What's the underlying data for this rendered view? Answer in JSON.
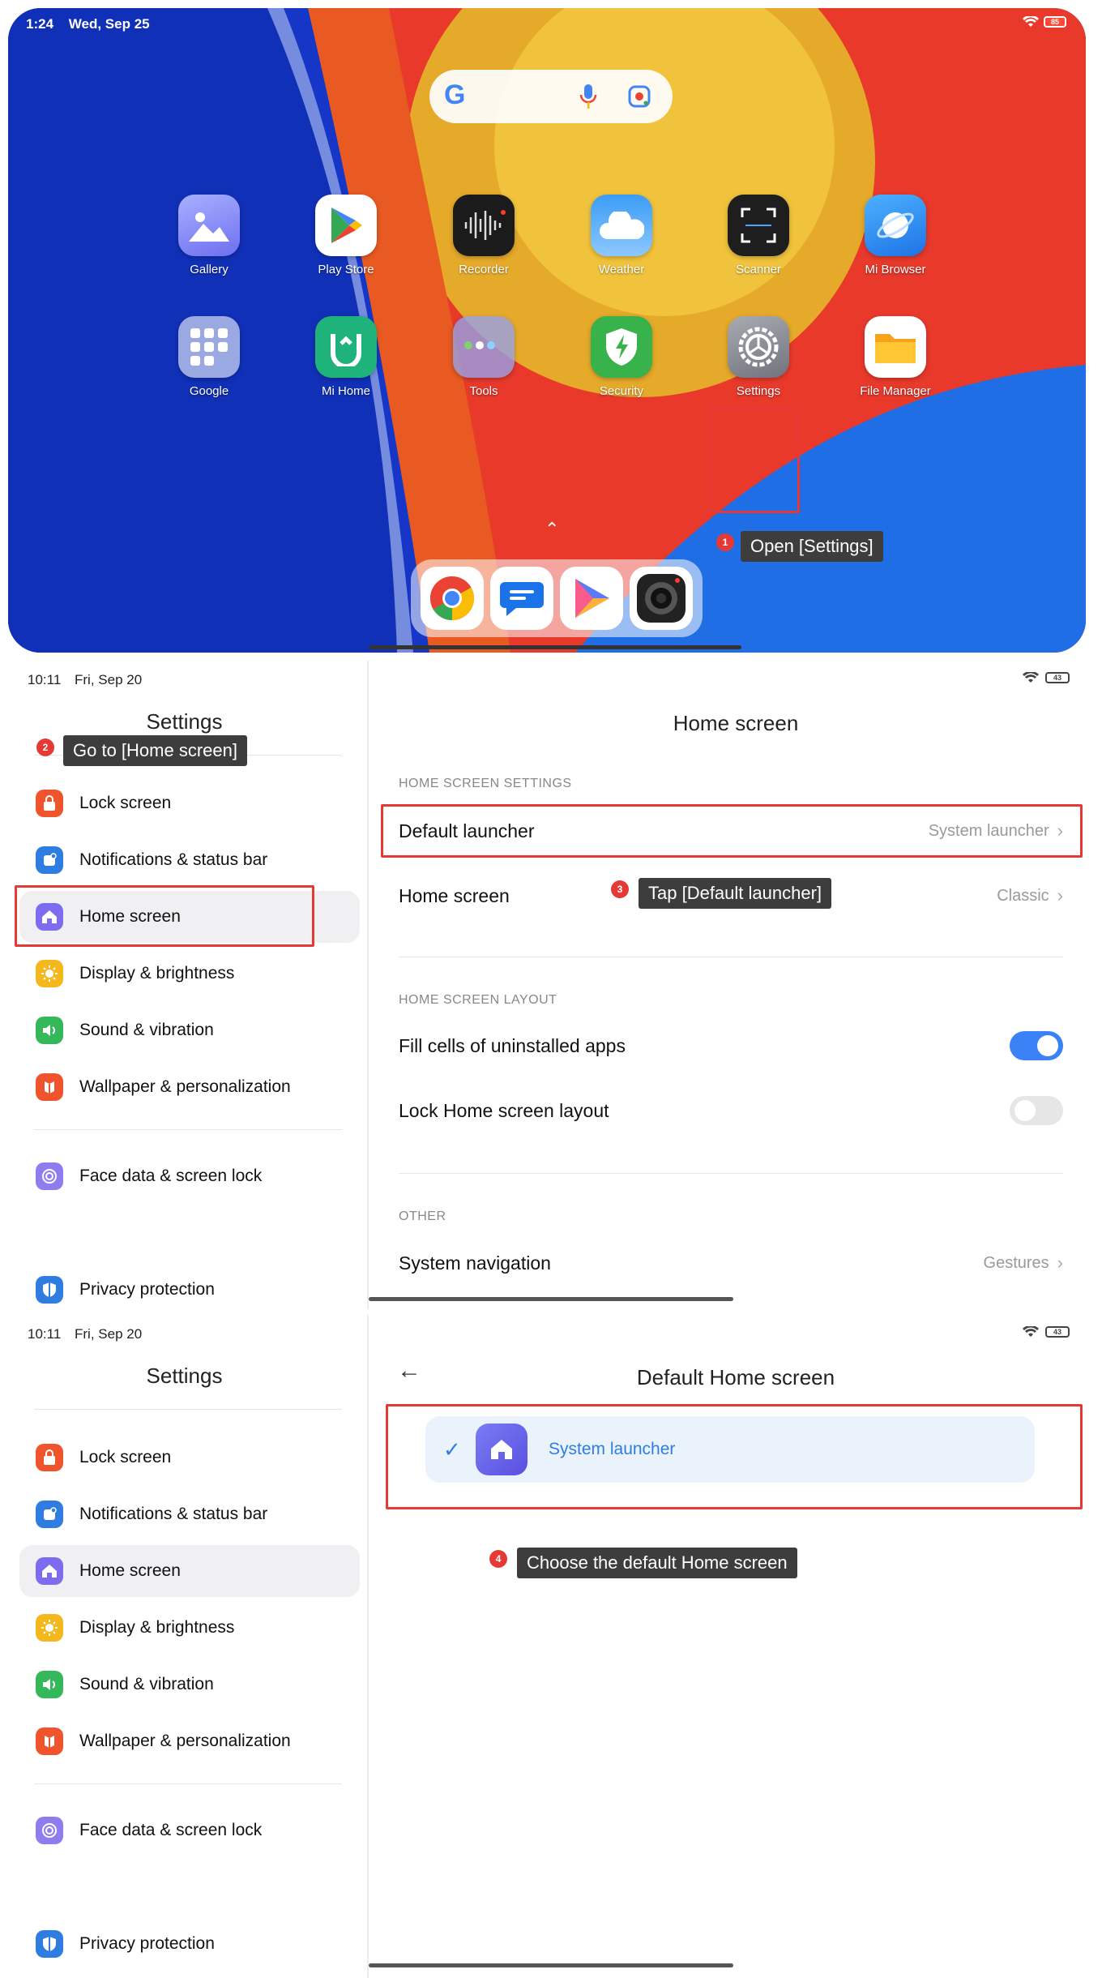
{
  "home": {
    "time": "1:24",
    "date": "Wed, Sep 25",
    "battery": "85",
    "apps": [
      {
        "label": "Gallery",
        "icon": "gallery-icon",
        "color": "#7b7ef6"
      },
      {
        "label": "Play Store",
        "icon": "play-store-icon",
        "color": "#ffffff"
      },
      {
        "label": "Recorder",
        "icon": "recorder-icon",
        "color": "#1b1b1b"
      },
      {
        "label": "Weather",
        "icon": "weather-icon",
        "color": "#3aa0f3"
      },
      {
        "label": "Scanner",
        "icon": "scanner-icon",
        "color": "#1e1e1e"
      },
      {
        "label": "Mi Browser",
        "icon": "browser-icon",
        "color": "#2f8ff0"
      },
      {
        "label": "Google",
        "icon": "folder-icon",
        "color": "#8b9bd8"
      },
      {
        "label": "Mi Home",
        "icon": "mi-home-icon",
        "color": "#1db37a"
      },
      {
        "label": "Tools",
        "icon": "folder-icon",
        "color": "#8d8fd6"
      },
      {
        "label": "Security",
        "icon": "security-icon",
        "color": "#38b24a"
      },
      {
        "label": "Settings",
        "icon": "settings-gear-icon",
        "color": "#8e9098"
      },
      {
        "label": "File Manager",
        "icon": "file-manager-icon",
        "color": "#f4a623"
      }
    ],
    "dock": [
      "chrome-icon",
      "messages-icon",
      "video-icon",
      "camera-icon"
    ],
    "step1_badge": "1",
    "step1_tip": "Open [Settings]"
  },
  "settings_panel_1": {
    "time": "10:11",
    "date": "Fri, Sep 20",
    "battery": "43",
    "left_title": "Settings",
    "step2_badge": "2",
    "step2_tip": "Go to [Home screen]",
    "right_title": "Home screen",
    "section_home_settings": "HOME SCREEN SETTINGS",
    "default_launcher_label": "Default launcher",
    "default_launcher_value": "System launcher",
    "home_screen_label": "Home screen",
    "home_screen_value": "Classic",
    "step3_badge": "3",
    "step3_tip": "Tap [Default launcher]",
    "section_layout": "HOME SCREEN LAYOUT",
    "fill_cells_label": "Fill cells of uninstalled apps",
    "fill_cells_on": true,
    "lock_layout_label": "Lock Home screen layout",
    "lock_layout_on": false,
    "section_other": "OTHER",
    "system_nav_label": "System navigation",
    "system_nav_value": "Gestures"
  },
  "nav_items": [
    {
      "label": "Lock screen",
      "icon": "lock-icon",
      "color": "#f0542d"
    },
    {
      "label": "Notifications & status bar",
      "icon": "notifications-icon",
      "color": "#2f7de1"
    },
    {
      "label": "Home screen",
      "icon": "home-icon",
      "color": "#7b6cf0"
    },
    {
      "label": "Display & brightness",
      "icon": "sun-icon",
      "color": "#f5b81c"
    },
    {
      "label": "Sound & vibration",
      "icon": "speaker-icon",
      "color": "#35b85a"
    },
    {
      "label": "Wallpaper & personalization",
      "icon": "wallpaper-icon",
      "color": "#f0542d"
    },
    {
      "label": "Face data & screen lock",
      "icon": "face-lock-icon",
      "color": "#8f7df0"
    },
    {
      "label": "Privacy protection",
      "icon": "privacy-icon",
      "color": "#2f7de1"
    }
  ],
  "settings_panel_2": {
    "time": "10:11",
    "date": "Fri, Sep 20",
    "battery": "43",
    "left_title": "Settings",
    "right_title": "Default Home screen",
    "launcher_option": "System launcher",
    "step4_badge": "4",
    "step4_tip": "Choose the default Home screen"
  }
}
